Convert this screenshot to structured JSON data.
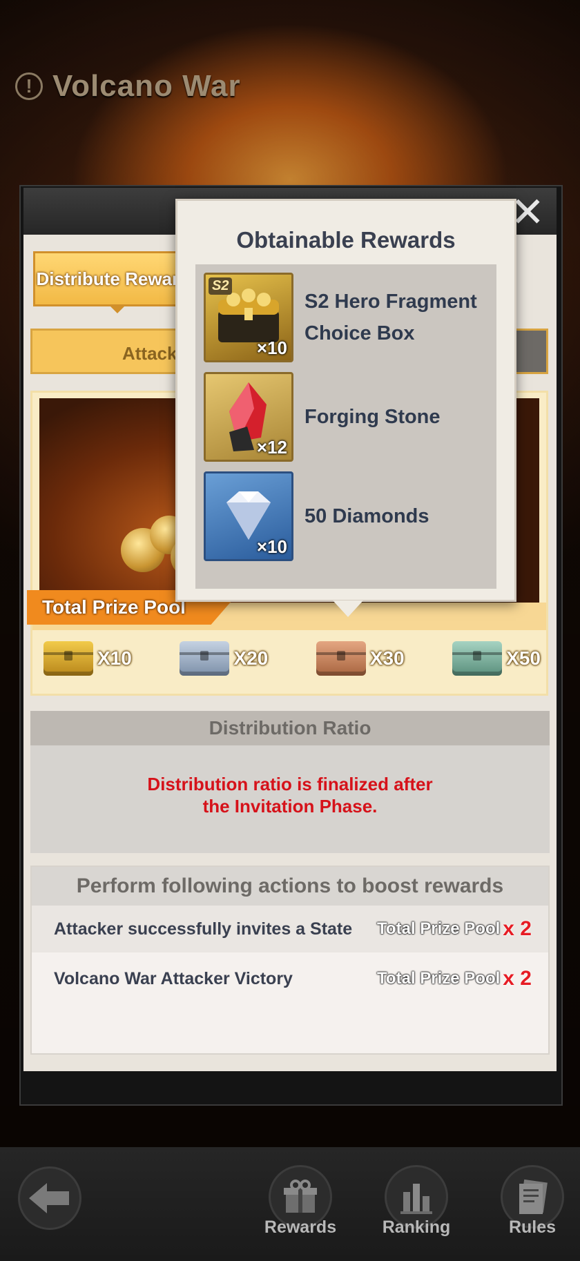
{
  "header": {
    "title": "Volcano War"
  },
  "tabs": {
    "distribute": "Distribute Rewards",
    "attack": "Attack"
  },
  "prize_pool": {
    "label": "Total Prize Pool",
    "chests": [
      {
        "icon": "gold-chest-icon",
        "color": "#d8a726",
        "count": "X10"
      },
      {
        "icon": "silver-chest-icon",
        "color": "#9fb0c6",
        "count": "X20"
      },
      {
        "icon": "bronze-chest-icon",
        "color": "#c9845c",
        "count": "X30"
      },
      {
        "icon": "jade-chest-icon",
        "color": "#7fb3a0",
        "count": "X50"
      }
    ]
  },
  "distribution": {
    "header": "Distribution Ratio",
    "message": "Distribution ratio is finalized after the Invitation Phase."
  },
  "boost": {
    "header": "Perform following actions to boost rewards",
    "rows": [
      {
        "text": "Attacker successfully invites a State",
        "pool": "Total Prize Pool",
        "mult": "x 2"
      },
      {
        "text": "Volcano War Attacker Victory",
        "pool": "Total Prize Pool",
        "mult": "x 2"
      }
    ]
  },
  "popup": {
    "title": "Obtainable Rewards",
    "items": [
      {
        "name": "S2 Hero Fragment Choice Box",
        "count": "×10",
        "icon": "treasure-chest-icon",
        "tag": "S2"
      },
      {
        "name": "Forging Stone",
        "count": "×12",
        "icon": "forging-stone-icon"
      },
      {
        "name": "50 Diamonds",
        "count": "×10",
        "icon": "diamond-icon"
      }
    ]
  },
  "nav": {
    "rewards": "Rewards",
    "ranking": "Ranking",
    "rules": "Rules"
  }
}
